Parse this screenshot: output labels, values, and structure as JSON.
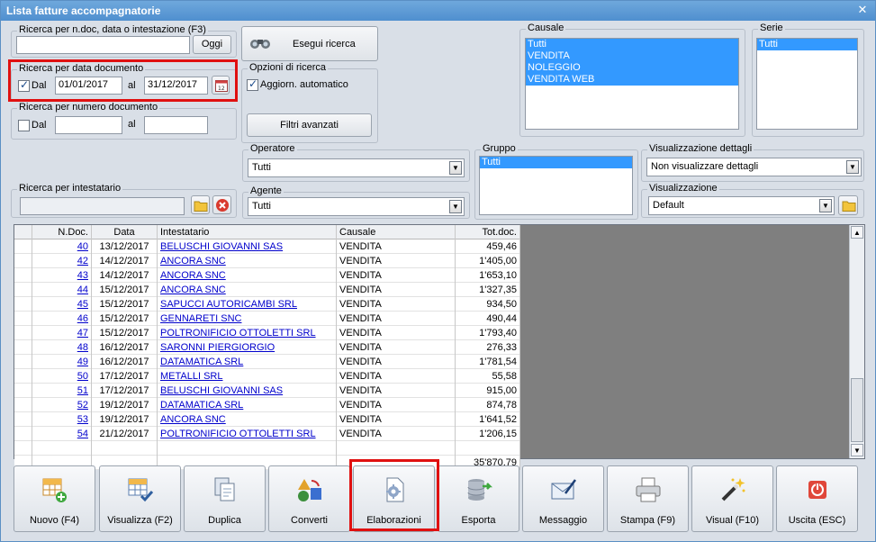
{
  "window": {
    "title": "Lista fatture accompagnatorie",
    "close_glyph": "✕"
  },
  "search_ndoc": {
    "label": "Ricerca per n.doc, data o intestazione (F3)",
    "value": "",
    "button": "Oggi"
  },
  "search_btn": {
    "label": "Esegui ricerca",
    "icon": "binoculars-icon"
  },
  "date_search": {
    "label": "Ricerca per data documento",
    "dal_label": "Dal",
    "from": "01/01/2017",
    "al_label": "al",
    "to": "31/12/2017",
    "checked": true
  },
  "number_search": {
    "label": "Ricerca per numero documento",
    "dal_label": "Dal",
    "from": "",
    "al_label": "al",
    "to": "",
    "checked": false
  },
  "options": {
    "label": "Opzioni di ricerca",
    "auto_update": "Aggiorn. automatico",
    "filters_button": "Filtri avanzati"
  },
  "causale": {
    "label": "Causale",
    "items": [
      "Tutti",
      "VENDITA",
      "NOLEGGIO",
      "VENDITA WEB"
    ]
  },
  "serie": {
    "label": "Serie",
    "items": [
      "Tutti"
    ]
  },
  "operatore": {
    "label": "Operatore",
    "value": "Tutti"
  },
  "agente": {
    "label": "Agente",
    "value": "Tutti"
  },
  "gruppo": {
    "label": "Gruppo",
    "items": [
      "Tutti"
    ]
  },
  "vis_dettagli": {
    "label": "Visualizzazione dettagli",
    "value": "Non visualizzare dettagli"
  },
  "visualizzazione": {
    "label": "Visualizzazione",
    "value": "Default"
  },
  "intestatario": {
    "label": "Ricerca per intestatario",
    "value": ""
  },
  "table": {
    "headers": [
      "N.Doc.",
      "Data",
      "Intestatario",
      "Causale",
      "Tot.doc."
    ],
    "rows": [
      [
        "40",
        "13/12/2017",
        "BELUSCHI GIOVANNI SAS",
        "VENDITA",
        "459,46"
      ],
      [
        "42",
        "14/12/2017",
        "ANCORA SNC",
        "VENDITA",
        "1'405,00"
      ],
      [
        "43",
        "14/12/2017",
        "ANCORA SNC",
        "VENDITA",
        "1'653,10"
      ],
      [
        "44",
        "15/12/2017",
        "ANCORA SNC",
        "VENDITA",
        "1'327,35"
      ],
      [
        "45",
        "15/12/2017",
        "SAPUCCI AUTORICAMBI SRL",
        "VENDITA",
        "934,50"
      ],
      [
        "46",
        "15/12/2017",
        "GENNARETI SNC",
        "VENDITA",
        "490,44"
      ],
      [
        "47",
        "15/12/2017",
        "POLTRONIFICIO OTTOLETTI SRL",
        "VENDITA",
        "1'793,40"
      ],
      [
        "48",
        "16/12/2017",
        "SARONNI PIERGIORGIO",
        "VENDITA",
        "276,33"
      ],
      [
        "49",
        "16/12/2017",
        "DATAMATICA SRL",
        "VENDITA",
        "1'781,54"
      ],
      [
        "50",
        "17/12/2017",
        "METALLI SRL",
        "VENDITA",
        "55,58"
      ],
      [
        "51",
        "17/12/2017",
        "BELUSCHI GIOVANNI SAS",
        "VENDITA",
        "915,00"
      ],
      [
        "52",
        "19/12/2017",
        "DATAMATICA SRL",
        "VENDITA",
        "874,78"
      ],
      [
        "53",
        "19/12/2017",
        "ANCORA SNC",
        "VENDITA",
        "1'641,52"
      ],
      [
        "54",
        "21/12/2017",
        "POLTRONIFICIO OTTOLETTI SRL",
        "VENDITA",
        "1'206,15"
      ]
    ],
    "total": "35'870,79"
  },
  "toolbar": [
    {
      "label": "Nuovo (F4)",
      "icon": "new-grid-icon"
    },
    {
      "label": "Visualizza (F2)",
      "icon": "view-grid-icon"
    },
    {
      "label": "Duplica",
      "icon": "duplicate-icon"
    },
    {
      "label": "Converti",
      "icon": "convert-icon"
    },
    {
      "label": "Elaborazioni",
      "icon": "processing-gear-icon"
    },
    {
      "label": "Esporta",
      "icon": "export-database-icon"
    },
    {
      "label": "Messaggio",
      "icon": "message-envelope-icon"
    },
    {
      "label": "Stampa (F9)",
      "icon": "printer-icon"
    },
    {
      "label": "Visual (F10)",
      "icon": "magic-wand-icon"
    },
    {
      "label": "Uscita (ESC)",
      "icon": "exit-power-icon"
    }
  ]
}
